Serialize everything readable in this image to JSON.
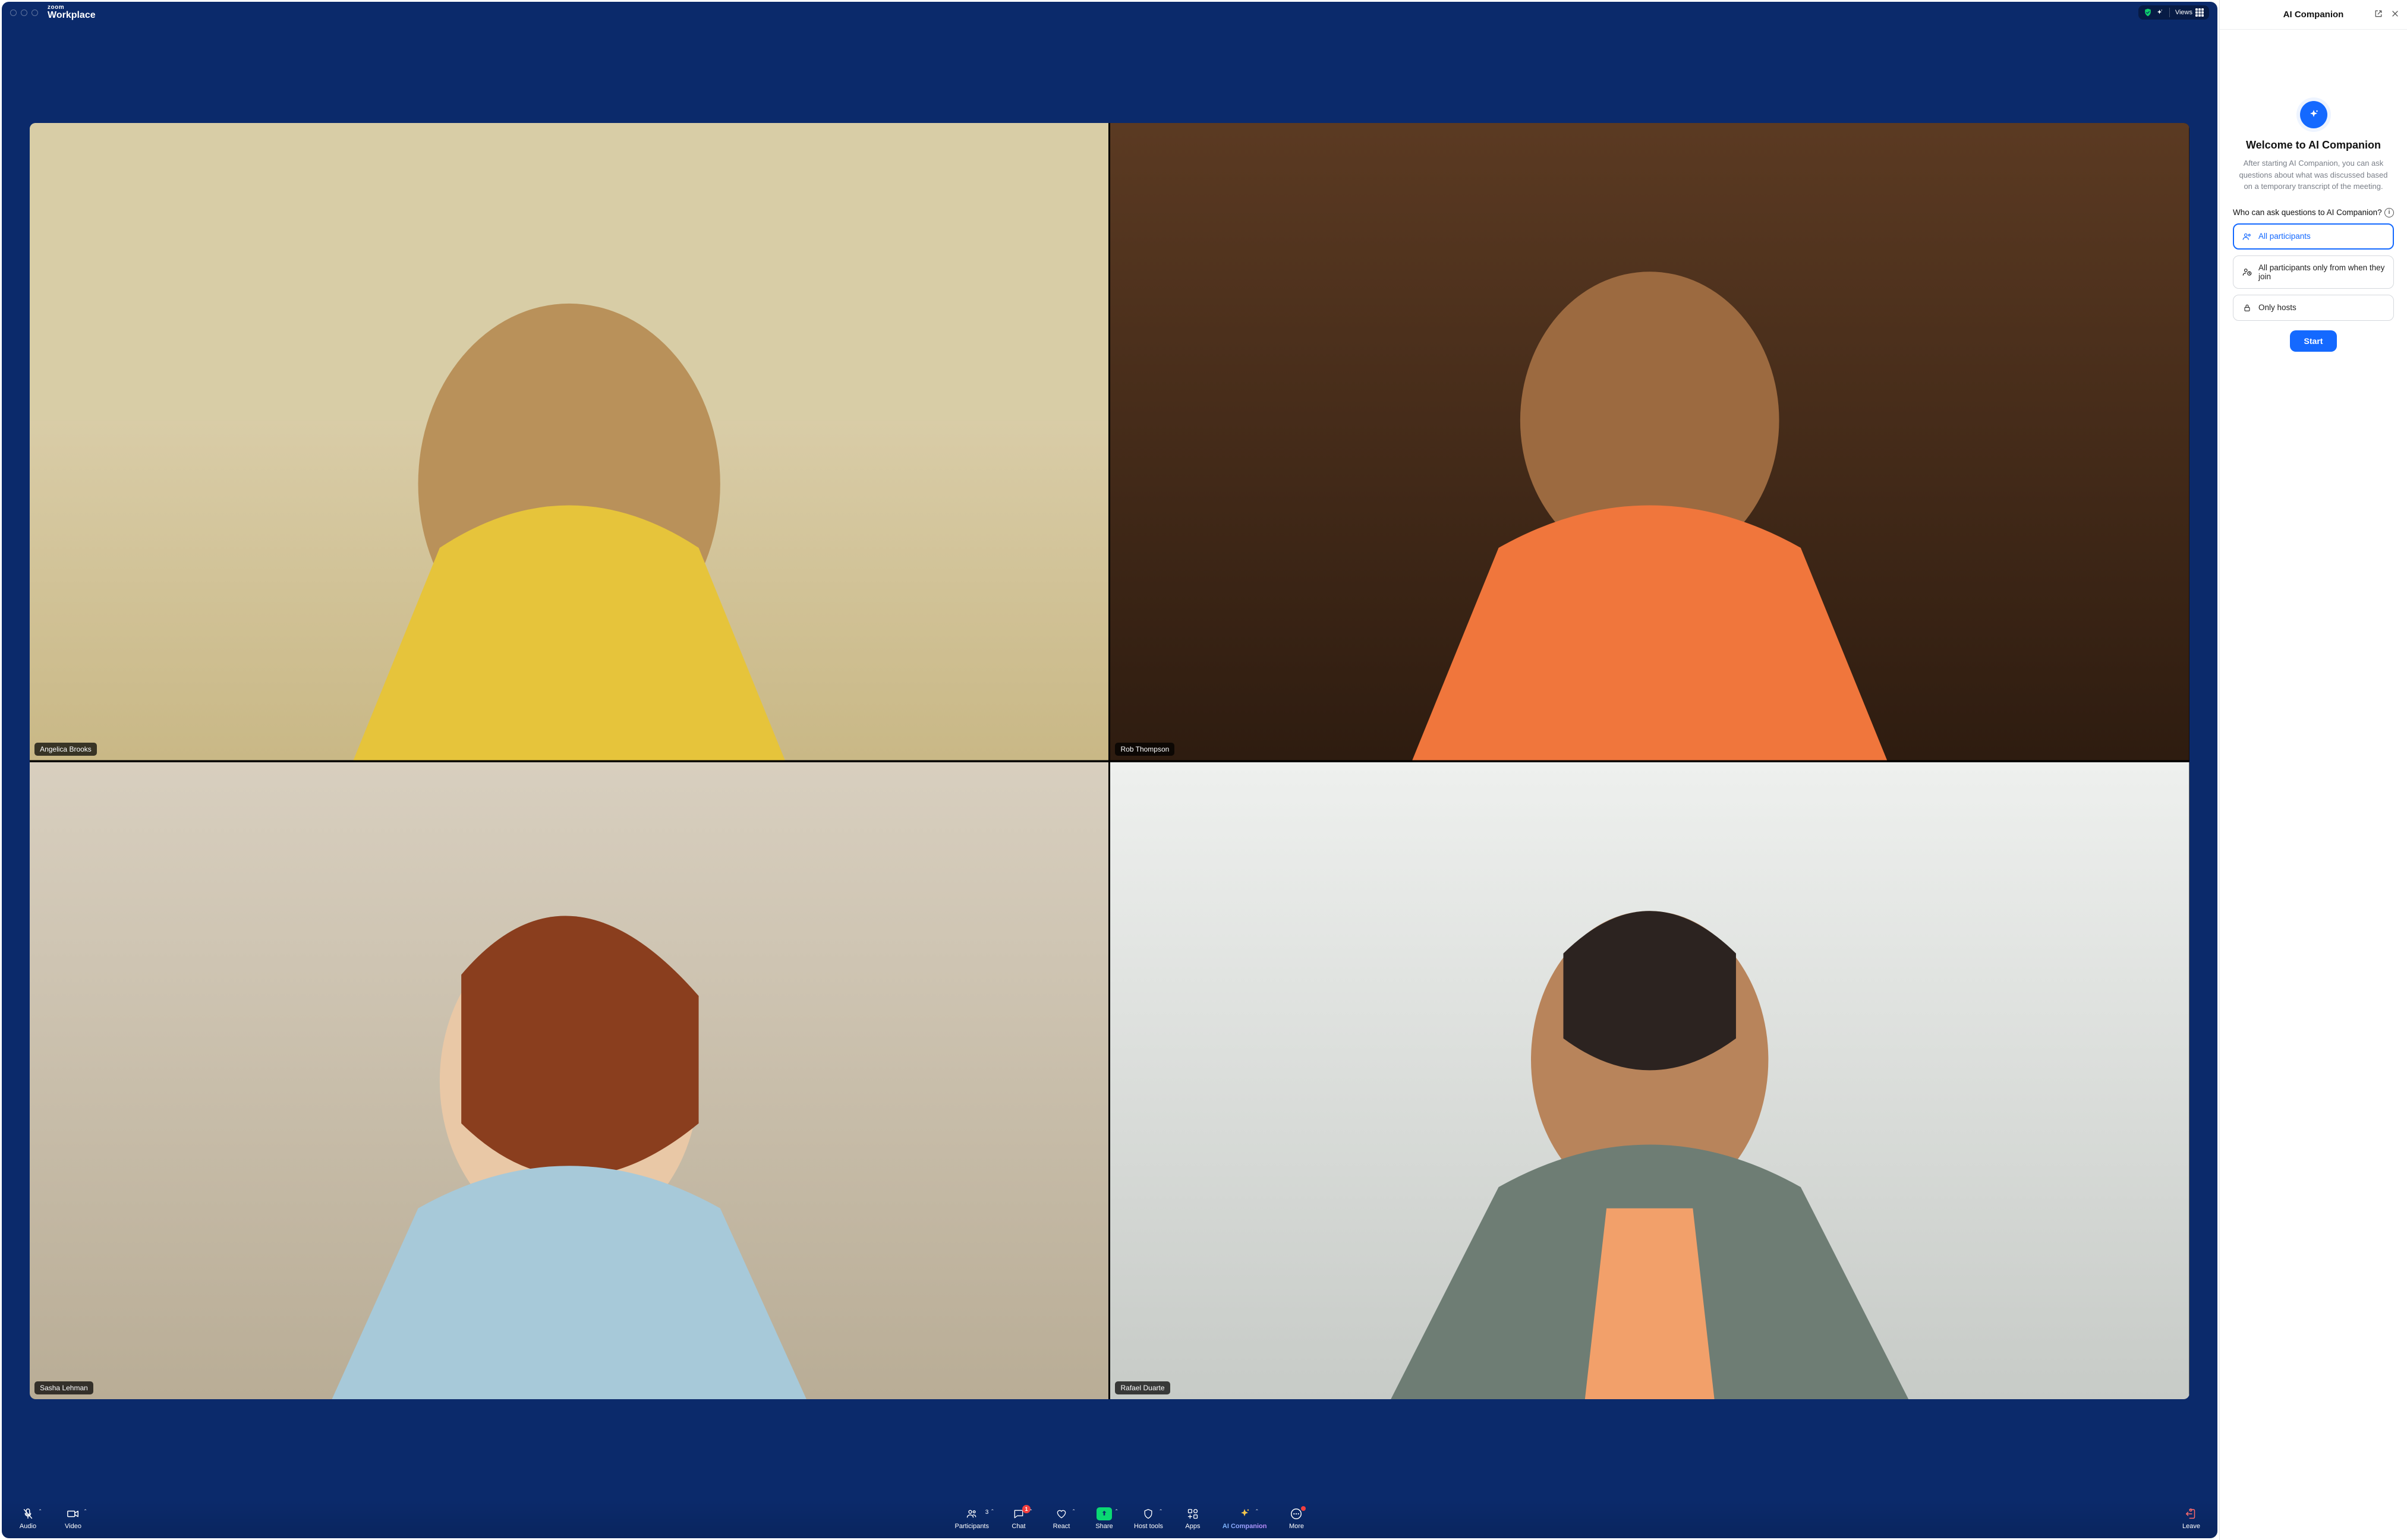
{
  "app": {
    "brand_top": "zoom",
    "brand_bottom": "Workplace",
    "views_label": "Views"
  },
  "participants_grid": [
    {
      "name": "Angelica Brooks"
    },
    {
      "name": "Rob Thompson"
    },
    {
      "name": "Sasha Lehman"
    },
    {
      "name": "Rafael Duarte"
    }
  ],
  "toolbar": {
    "audio": "Audio",
    "video": "Video",
    "participants": "Participants",
    "participants_count": "3",
    "chat": "Chat",
    "chat_badge": "1",
    "react": "React",
    "share": "Share",
    "host_tools": "Host tools",
    "apps": "Apps",
    "ai": "AI Companion",
    "more": "More",
    "leave": "Leave"
  },
  "panel": {
    "title": "AI Companion",
    "welcome_title": "Welcome to AI Companion",
    "welcome_desc": "After starting AI Companion, you can ask questions about what was discussed based on a temporary transcript of the meeting.",
    "question": "Who can ask questions to AI Companion?",
    "options": [
      {
        "label": "All participants",
        "selected": true,
        "icon": "people"
      },
      {
        "label": "All participants only from when they join",
        "selected": false,
        "icon": "person-clock"
      },
      {
        "label": "Only hosts",
        "selected": false,
        "icon": "lock"
      }
    ],
    "start": "Start"
  }
}
